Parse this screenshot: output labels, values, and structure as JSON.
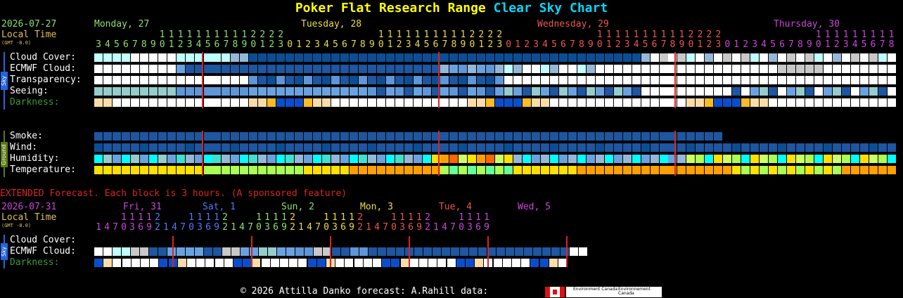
{
  "title": {
    "station": "Poker Flat Research Range",
    "suffix": "Clear Sky Chart"
  },
  "colors": {
    "cloud_white": "#ffffff",
    "cloud_light": "#c0ffff",
    "cloud_med": "#96b8d8",
    "clear": "#0b4e94",
    "good": "#1e6ec8",
    "dawn": "#fcfcfc",
    "sand": "#f9dca8",
    "hum_cyan": "#00ffff",
    "temp_yellow": "#ffe000",
    "temp_orange": "#ffa000",
    "temp_green": "#aaff55"
  },
  "main": {
    "date": "2026-07-27",
    "local_time": "Local Time",
    "gmt": "(GMT -8.0)",
    "days": [
      {
        "label": "Monday, 27",
        "color": "#8fe070"
      },
      {
        "label": "Tuesday, 28",
        "color": "#eedd44"
      },
      {
        "label": "Wednesday, 29",
        "color": "#ee5555"
      },
      {
        "label": "Thursday, 30",
        "color": "#cc44dd"
      }
    ],
    "rows": {
      "cloud_cover": "Cloud Cover:",
      "ecmwf_cloud": "ECMWF Cloud:",
      "transparency": "Transparency:",
      "seeing": "Seeing:",
      "darkness": "Darkness:",
      "smoke": "Smoke:",
      "wind": "Wind:",
      "humidity": "Humidity:",
      "temperature": "Temperature:"
    },
    "sky_tab": "Sky",
    "ground_tab": "Ground"
  },
  "extended": {
    "heading": "EXTENDED Forecast. Each block is 3 hours. (A sponsored feature)",
    "date": "2026-07-31",
    "local_time": "Local Time",
    "gmt": "(GMT -8.0)",
    "days": [
      {
        "label": "Fri, 31",
        "color": "#cc44dd"
      },
      {
        "label": "Sat, 1",
        "color": "#5577ff"
      },
      {
        "label": "Sun, 2",
        "color": "#8fe070"
      },
      {
        "label": "Mon, 3",
        "color": "#eedd44"
      },
      {
        "label": "Tue, 4",
        "color": "#ee5555"
      },
      {
        "label": "Wed, 5",
        "color": "#cc44dd"
      }
    ],
    "rows": {
      "cloud_cover": "Cloud Cover:",
      "ecmwf_cloud": "ECMWF Cloud:",
      "darkness": "Darkness:"
    },
    "sky_tab": "Sky"
  },
  "footer": {
    "text": "© 2026 Attilla Danko  forecast: A.Rahill  data:",
    "logo_text1": "Environment Canada",
    "logo_text2": "Environnement Canada"
  }
}
